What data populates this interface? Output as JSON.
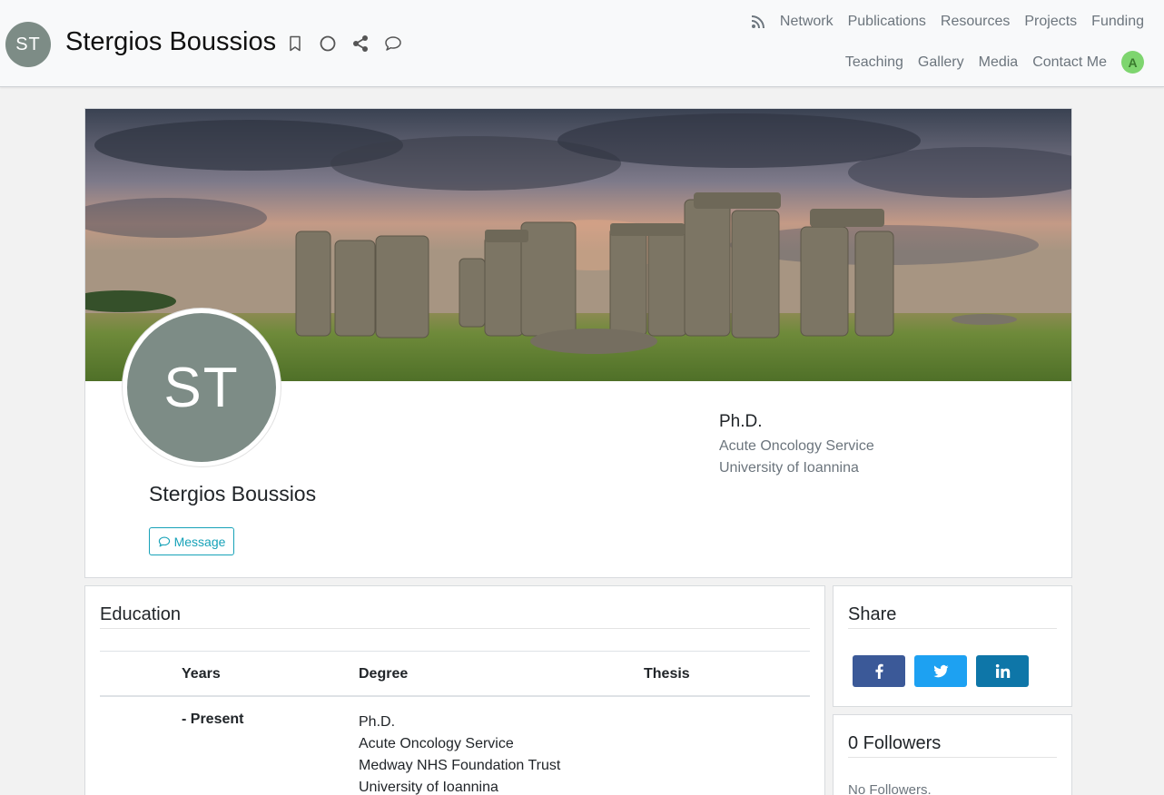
{
  "header": {
    "avatar_initials": "ST",
    "name": "Stergios Boussios",
    "icons": [
      "bookmark-icon",
      "circle-icon",
      "share-icon",
      "comment-icon"
    ]
  },
  "nav": {
    "row1": [
      "Network",
      "Publications",
      "Resources",
      "Projects",
      "Funding"
    ],
    "row2": [
      "Teaching",
      "Gallery",
      "Media",
      "Contact Me"
    ],
    "user_initial": "A"
  },
  "profile": {
    "avatar_initials": "ST",
    "name": "Stergios Boussios",
    "message_label": "Message",
    "degree": "Ph.D.",
    "department": "Acute Oncology Service",
    "university": "University of Ioannina"
  },
  "education": {
    "title": "Education",
    "columns": [
      "Years",
      "Degree",
      "Thesis"
    ],
    "rows": [
      {
        "years": "- Present",
        "degree_lines": [
          "Ph.D.",
          "Acute Oncology Service",
          "Medway NHS Foundation Trust",
          "University of Ioannina"
        ],
        "thesis": ""
      }
    ]
  },
  "share": {
    "title": "Share",
    "buttons": [
      "facebook",
      "twitter",
      "linkedin"
    ]
  },
  "followers": {
    "title": "0 Followers",
    "empty_text": "No Followers."
  },
  "colors": {
    "accent": "#17a2b8",
    "facebook": "#3b5998",
    "twitter": "#1da1f2",
    "linkedin": "#0e76a8",
    "avatar": "#7d8c86"
  }
}
